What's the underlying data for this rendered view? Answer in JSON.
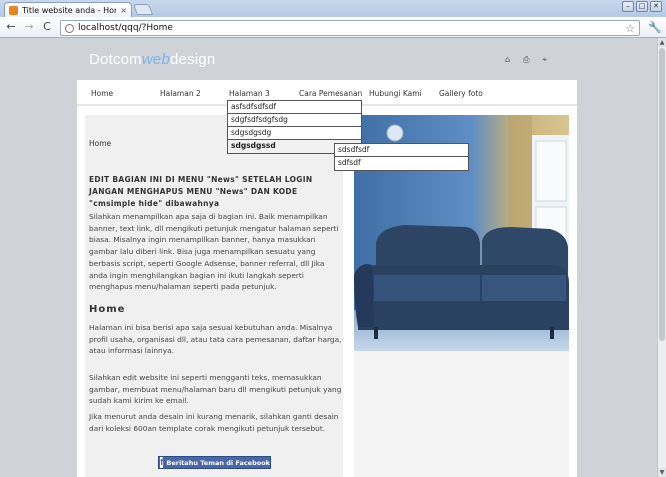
{
  "browser": {
    "tab_title": "Title website anda - Home",
    "tab_close": "×",
    "url": "localhost/qqq/?Home",
    "window_buttons": [
      "–",
      "□",
      "✕"
    ],
    "nav": {
      "back": "←",
      "forward": "→",
      "reload": "C"
    },
    "star": "☆",
    "wrench": "🔧"
  },
  "site": {
    "logo_part1": "Dotcom",
    "logo_part2": "web",
    "logo_part3": "design",
    "header_icons": [
      "home-icon",
      "print-icon",
      "sitemap-icon"
    ],
    "header_icon_glyphs": [
      "⌂",
      "⎙",
      "⌖"
    ]
  },
  "menu": {
    "items": [
      {
        "label": "Home"
      },
      {
        "label": "Halaman 2"
      },
      {
        "label": "Halaman 3"
      },
      {
        "label": "Cara Pemesanan"
      },
      {
        "label": "Hubungi Kami"
      },
      {
        "label": "Gallery foto"
      }
    ],
    "dropdown": [
      "asfsdfsdfsdf",
      "sdgfsdfsdgfsdg",
      "sdgsdgsdg",
      "sdgsdgssd"
    ],
    "subdropdown": [
      "sdsdfsdf",
      "sdfsdf"
    ]
  },
  "content": {
    "breadcrumb": "Home",
    "intro_title": "EDIT BAGIAN INI DI MENU \"News\" SETELAH LOGIN JANGAN MENGHAPUS MENU \"News\" DAN KODE \"cmsimple hide\" dibawahnya",
    "intro_text": "Silahkan menampilkan apa saja di bagian ini. Baik menampilkan banner, text link, dll mengikuti petunjuk mengatur halaman seperti biasa. Misalnya ingin menampilkan banner, hanya masukkan gambar lalu diberi link. Bisa juga menampilkan sesuatu yang berbasis script, seperti Google Adsense, banner referral, dll Jika anda ingin menghilangkan bagian ini ikuti langkah seperti menghapus menu/halaman seperti pada petunjuk.",
    "home_heading": "Home",
    "p1": "Halaman ini bisa berisi apa saja sesuai kebutuhan anda. Misalnya profil usaha, organisasi dll, atau tata cara pemesanan, daftar harga, atau informasi lainnya.",
    "p2": "Silahkan edit website ini seperti mengganti teks, memasukkan gambar, membuat menu/halaman baru dll mengikuti petunjuk yang sudah kami kirim ke email.",
    "p3": "Jika menurut anda desain ini kurang menarik, silahkan ganti desain dari koleksi 600an template corak mengikuti petunjuk tersebut.",
    "fb_icon": "f",
    "fb_button": "Beritahu Teman di Facebook"
  },
  "colors": {
    "page_bg": "#cfd3d8",
    "logo_accent": "#7fb3e8",
    "facebook": "#4a67a8"
  }
}
